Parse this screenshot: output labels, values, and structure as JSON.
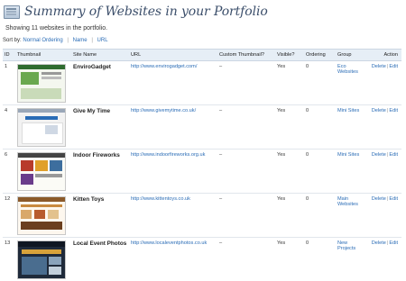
{
  "page": {
    "title": "Summary of Websites in your Portfolio",
    "summary": "Showing 11 websites in the portfolio."
  },
  "sort": {
    "label": "Sort by:",
    "options": [
      "Normal Ordering",
      "Name",
      "URL"
    ]
  },
  "table": {
    "headers": {
      "id": "ID",
      "thumbnail": "Thumbnail",
      "site_name": "Site Name",
      "url": "URL",
      "custom_thumbnail": "Custom Thumbnail?",
      "visible": "Visible?",
      "ordering": "Ordering",
      "group": "Group",
      "action": "Action"
    },
    "rows": [
      {
        "id": "1",
        "name": "EnviroGadget",
        "url": "http://www.envirogadget.com/",
        "custom": "–",
        "visible": "Yes",
        "ordering": "0",
        "group": "Eco Websites",
        "delete": "Delete",
        "edit": "Edit",
        "thumb_icon": "envirogadget-thumbnail"
      },
      {
        "id": "4",
        "name": "Give My Time",
        "url": "http://www.givemytime.co.uk/",
        "custom": "–",
        "visible": "Yes",
        "ordering": "0",
        "group": "Mini Sites",
        "delete": "Delete",
        "edit": "Edit",
        "thumb_icon": "givemytime-thumbnail"
      },
      {
        "id": "6",
        "name": "Indoor Fireworks",
        "url": "http://www.indoorfireworks.org.uk",
        "custom": "–",
        "visible": "Yes",
        "ordering": "0",
        "group": "Mini Sites",
        "delete": "Delete",
        "edit": "Edit",
        "thumb_icon": "indoorfireworks-thumbnail"
      },
      {
        "id": "12",
        "name": "Kitten Toys",
        "url": "http://www.kittentoys.co.uk",
        "custom": "–",
        "visible": "Yes",
        "ordering": "0",
        "group": "Main Websites",
        "delete": "Delete",
        "edit": "Edit",
        "thumb_icon": "kittentoys-thumbnail"
      },
      {
        "id": "13",
        "name": "Local Event Photos",
        "url": "http://www.localeventphotos.co.uk",
        "custom": "–",
        "visible": "Yes",
        "ordering": "0",
        "group": "New Projects",
        "delete": "Delete",
        "edit": "Edit",
        "thumb_icon": "localeventphotos-thumbnail"
      }
    ]
  },
  "colors": {
    "title": "#3c4f6b",
    "link": "#2a6cb6",
    "header_bg": "#e6eef6"
  }
}
